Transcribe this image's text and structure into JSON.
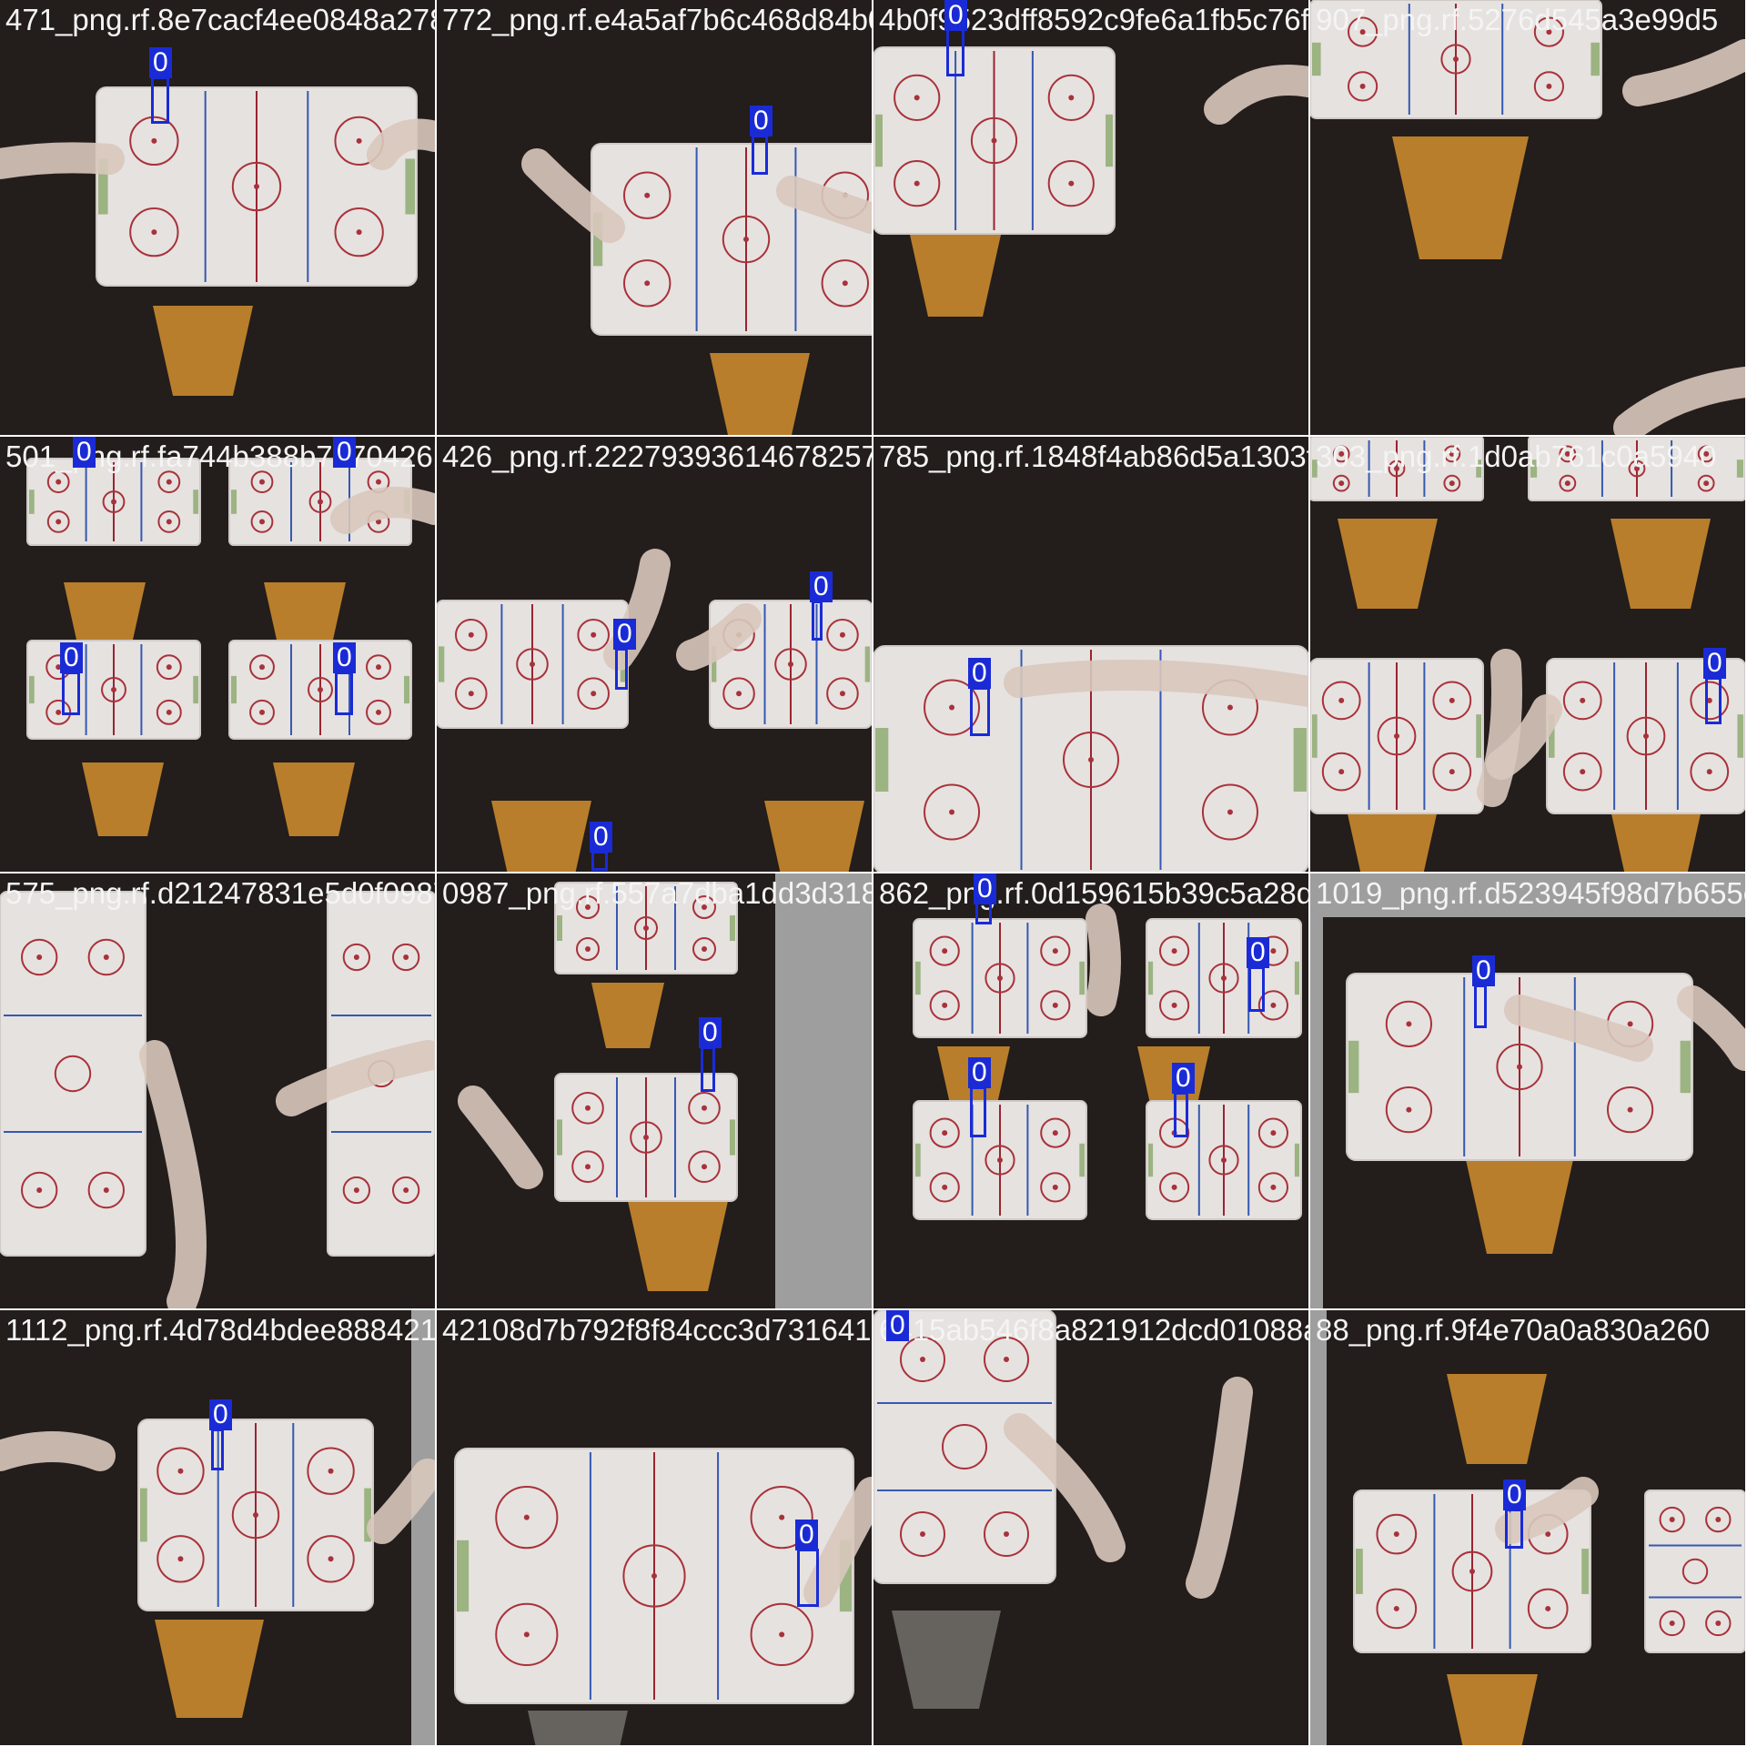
{
  "mosaic": {
    "tiles": [
      {
        "filename": "471_png.rf.8e7cacf4ee0848a278202b5f4245d2b6c468d8"
      },
      {
        "filename": "772_png.rf.e4a5af7b6c468d84b0f9523dff8592c9"
      },
      {
        "filename": "4b0f9523dff8592c9fe6a1fb5c76f9795276d545a3e99d"
      },
      {
        "filename": "907_png.rf.5276d545a3e99d5"
      },
      {
        "filename": "501_png.rf.fa744b388b7970426bd247a922d27793"
      },
      {
        "filename": "426_png.rf.22279393614678257b5cf18e48f4ab86d5a1"
      },
      {
        "filename": "785_png.rf.1848f4ab86d5a1303fa82e1fd0ab761c0a594"
      },
      {
        "filename": "303_png.rf.1d0ab761c0a5940"
      },
      {
        "filename": "575_png.rf.d21247831e5d0f0987f41cb557a7dba1dd3d31"
      },
      {
        "filename": "0987_png.rf.557a7dba1dd3d31862a5e6f0d159615"
      },
      {
        "filename": "862_png.rf.0d159615b39c5a28dde31019d523945f"
      },
      {
        "filename": "1019_png.rf.d523945f98d7b655ea"
      },
      {
        "filename": "1112_png.rf.4d78d4bdee88842108d7b792f8f84ccc3d73"
      },
      {
        "filename": "42108d7b792f8f84ccc3d7316415ab546f8a821912dcd010"
      },
      {
        "filename": "6415ab546f8a821912dcd01088a81869f4e70aa0a830a260"
      },
      {
        "filename": "88_png.rf.9f4e70a0a830a260"
      }
    ],
    "box_label": "0",
    "colors": {
      "box": "#1a2bd6",
      "label_text": "#ffffff",
      "filename_text": "#f4f4f4",
      "table": "#e6e2e0",
      "table_line": "#a8323a",
      "center_line": "#9a2430",
      "blue_line": "#3559b0",
      "floor": "#231d1b",
      "padding": "#9e9e9e"
    }
  }
}
